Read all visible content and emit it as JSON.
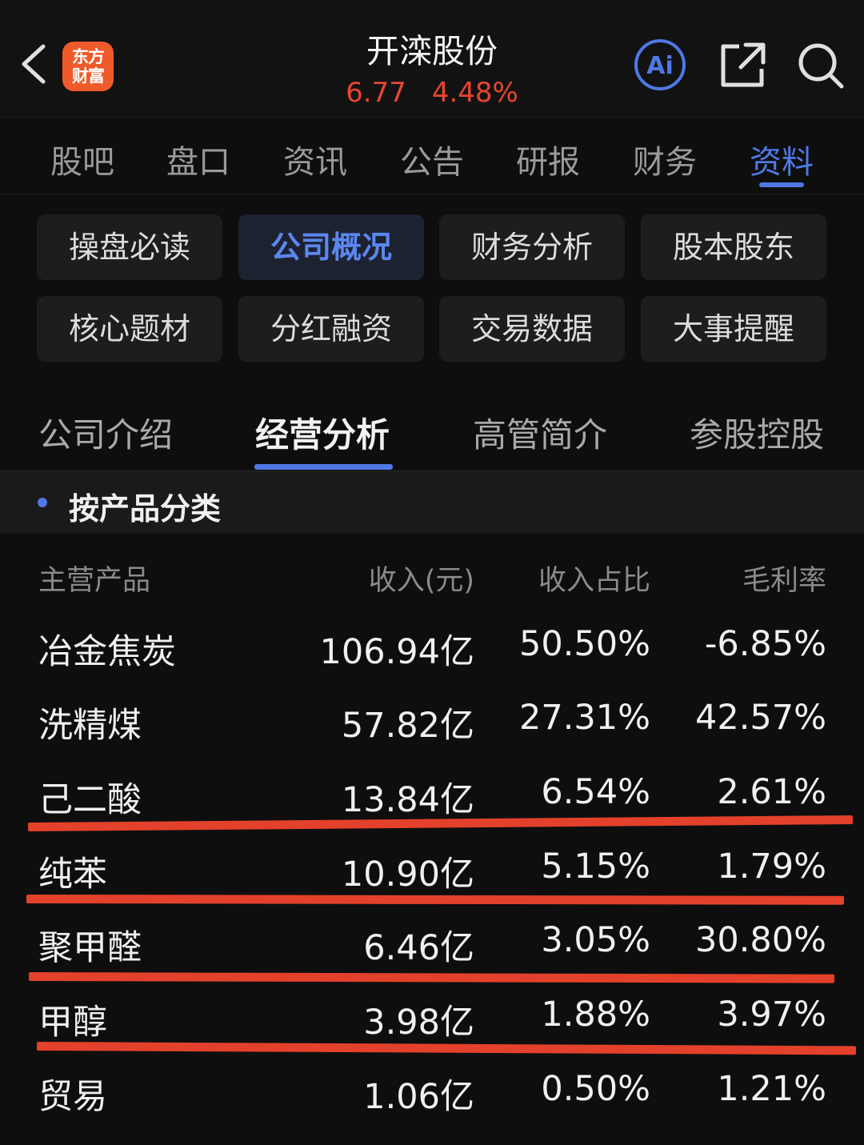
{
  "header": {
    "logo_text": "东方\n财富",
    "title": "开滦股份",
    "price": "6.77",
    "change": "4.48%",
    "accent": "#4f78e6",
    "down_color": "#e8462f"
  },
  "icons": {
    "back": "chevron-left-icon",
    "ai": "ai-assistant-icon",
    "share": "share-icon",
    "search": "search-icon"
  },
  "main_tabs": [
    "股吧",
    "盘口",
    "资讯",
    "公告",
    "研报",
    "财务",
    "资料"
  ],
  "active_main_tab": "资料",
  "grid": [
    [
      "操盘必读",
      "公司概况",
      "财务分析",
      "股本股东"
    ],
    [
      "核心题材",
      "分红融资",
      "交易数据",
      "大事提醒"
    ]
  ],
  "active_grid": "公司概况",
  "sub_tabs": [
    "公司介绍",
    "经营分析",
    "高管简介",
    "参股控股"
  ],
  "active_sub_tab": "经营分析",
  "section": {
    "title": "按产品分类"
  },
  "table": {
    "headers": [
      "主营产品",
      "收入(元)",
      "收入占比",
      "毛利率"
    ],
    "rows": [
      [
        "冶金焦炭",
        "106.94亿",
        "50.50%",
        "-6.85%"
      ],
      [
        "洗精煤",
        "57.82亿",
        "27.31%",
        "42.57%"
      ],
      [
        "己二酸",
        "13.84亿",
        "6.54%",
        "2.61%"
      ],
      [
        "纯苯",
        "10.90亿",
        "5.15%",
        "1.79%"
      ],
      [
        "聚甲醛",
        "6.46亿",
        "3.05%",
        "30.80%"
      ],
      [
        "甲醇",
        "3.98亿",
        "1.88%",
        "3.97%"
      ],
      [
        "贸易",
        "1.06亿",
        "0.50%",
        "1.21%"
      ]
    ]
  },
  "annotation_color": "#e3412b"
}
